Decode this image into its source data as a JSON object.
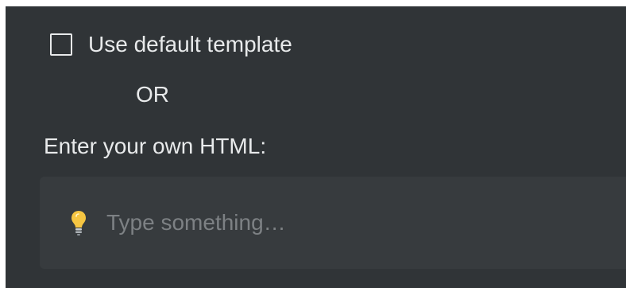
{
  "template": {
    "checkbox_label": "Use default template",
    "checked": false
  },
  "separator": {
    "text": "OR"
  },
  "custom_html": {
    "label": "Enter your own HTML:",
    "placeholder": "Type something…",
    "value": "",
    "icon": "lightbulb-icon"
  },
  "colors": {
    "panel_bg": "#303437",
    "input_bg": "#373b3e",
    "text": "#e8eaeb",
    "placeholder": "#7d8184",
    "bulb": "#f5c542"
  }
}
